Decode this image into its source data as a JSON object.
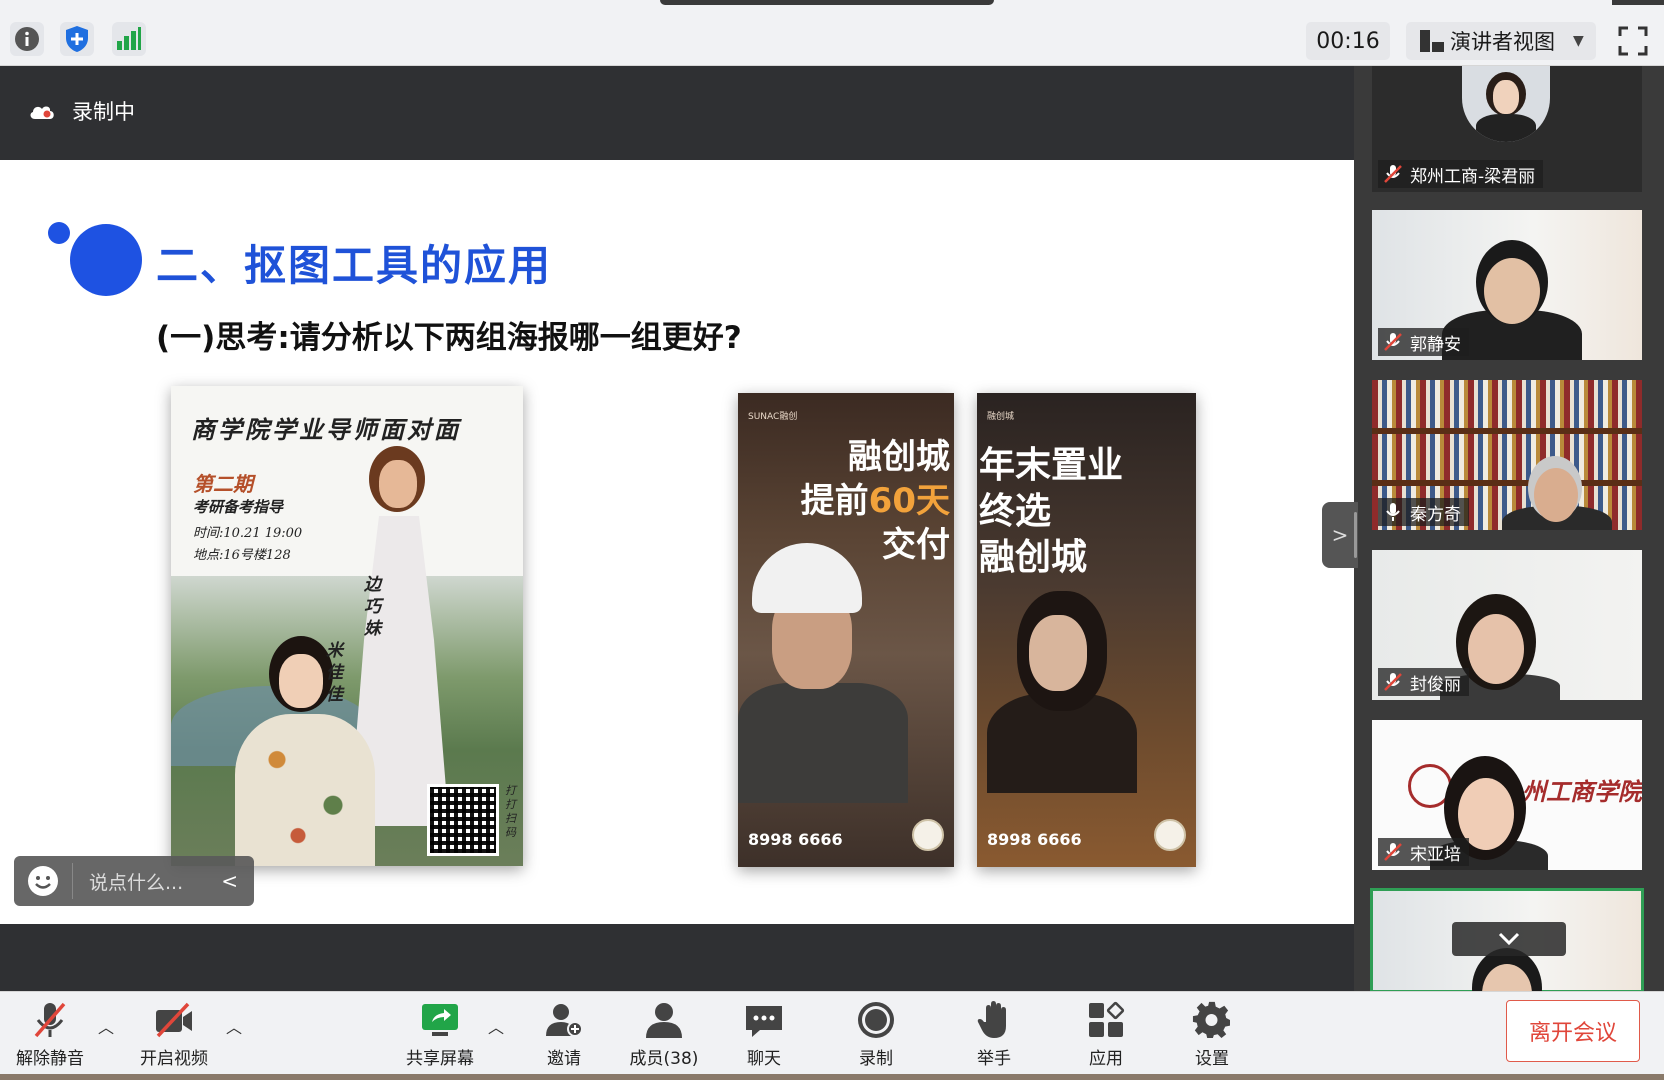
{
  "topbar": {
    "icons": [
      "info-icon",
      "shield-icon",
      "signal-icon"
    ],
    "timer": "00:16",
    "view_mode": "演讲者视图",
    "colors": {
      "shield": "#1f6fe0",
      "signal": "#21a548"
    }
  },
  "recording": {
    "label": "录制中"
  },
  "slide": {
    "title": "二、抠图工具的应用",
    "subtitle": "(一)思考:请分析以下两组海报哪一组更好?",
    "accent": "#1e52e2",
    "poster1": {
      "title": "商学院学业导师面对面",
      "issue": "第二期",
      "sub": "考研备考指导",
      "time": "时间:10.21 19:00",
      "place": "地点:16号楼128",
      "name1": "边巧妹",
      "name2": "米佳佳",
      "qr_text": "打打扫码"
    },
    "poster2": {
      "brand": "SUNAC融创",
      "headline_lines": [
        "融创城",
        "提前",
        "60天",
        "交付"
      ],
      "phone": "8998 6666"
    },
    "poster3": {
      "brand": "融创城",
      "headline_lines": [
        "年末置业",
        "终选",
        "融创城"
      ],
      "phone": "8998 6666"
    }
  },
  "chat": {
    "placeholder": "说点什么..."
  },
  "participants": [
    {
      "name": "郑州工商-梁君丽",
      "muted": true
    },
    {
      "name": "郭静安",
      "muted": true
    },
    {
      "name": "秦方奇",
      "muted": false
    },
    {
      "name": "封俊丽",
      "muted": true
    },
    {
      "name": "宋亚培",
      "muted": true,
      "background_text": "州工商学院"
    }
  ],
  "toolbar": {
    "unmute": "解除静音",
    "start_video": "开启视频",
    "share_screen": "共享屏幕",
    "invite": "邀请",
    "members": "成员(38)",
    "chat": "聊天",
    "record": "录制",
    "raise_hand": "举手",
    "apps": "应用",
    "settings": "设置",
    "leave": "离开会议",
    "colors": {
      "muted_red": "#e0463a",
      "share_green": "#21a548"
    }
  }
}
